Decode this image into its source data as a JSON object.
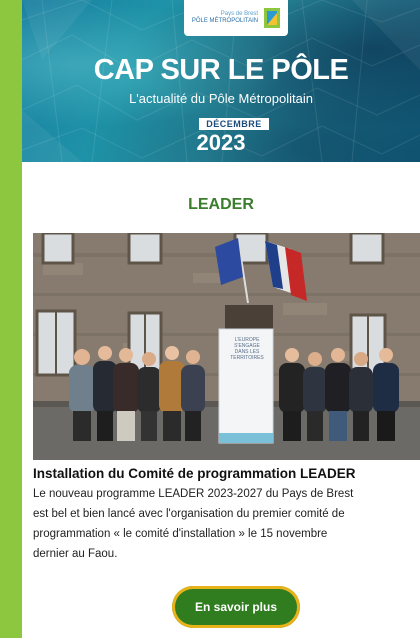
{
  "header": {
    "logo_line1": "Pays de Brest",
    "logo_line2": "PÔLE MÉTROPOLITAIN",
    "title": "CAP SUR LE PÔLE",
    "subtitle": "L'actualité du Pôle Métropolitain",
    "month": "DÉCEMBRE",
    "year": "2023"
  },
  "section": {
    "title": "LEADER"
  },
  "article": {
    "photo_icon": "group-photo",
    "banner_lines": [
      "L'EUROPE",
      "S'ENGAGE",
      "DANS LES",
      "TERRITOIRES"
    ],
    "title": "Installation du Comité de programmation LEADER",
    "lines": [
      "Le nouveau programme LEADER 2023-2027 du Pays de Brest",
      "est bel et bien lancé avec l'organisation du premier comité de",
      "programmation « le comité d'installation » le 15 novembre",
      "dernier au Faou."
    ],
    "cta_label": "En savoir plus"
  },
  "colors": {
    "page_bg": "#8dc63f",
    "accent_green": "#3a7d2c",
    "button_green": "#2f7d1f",
    "button_ring": "#e8b21a"
  }
}
